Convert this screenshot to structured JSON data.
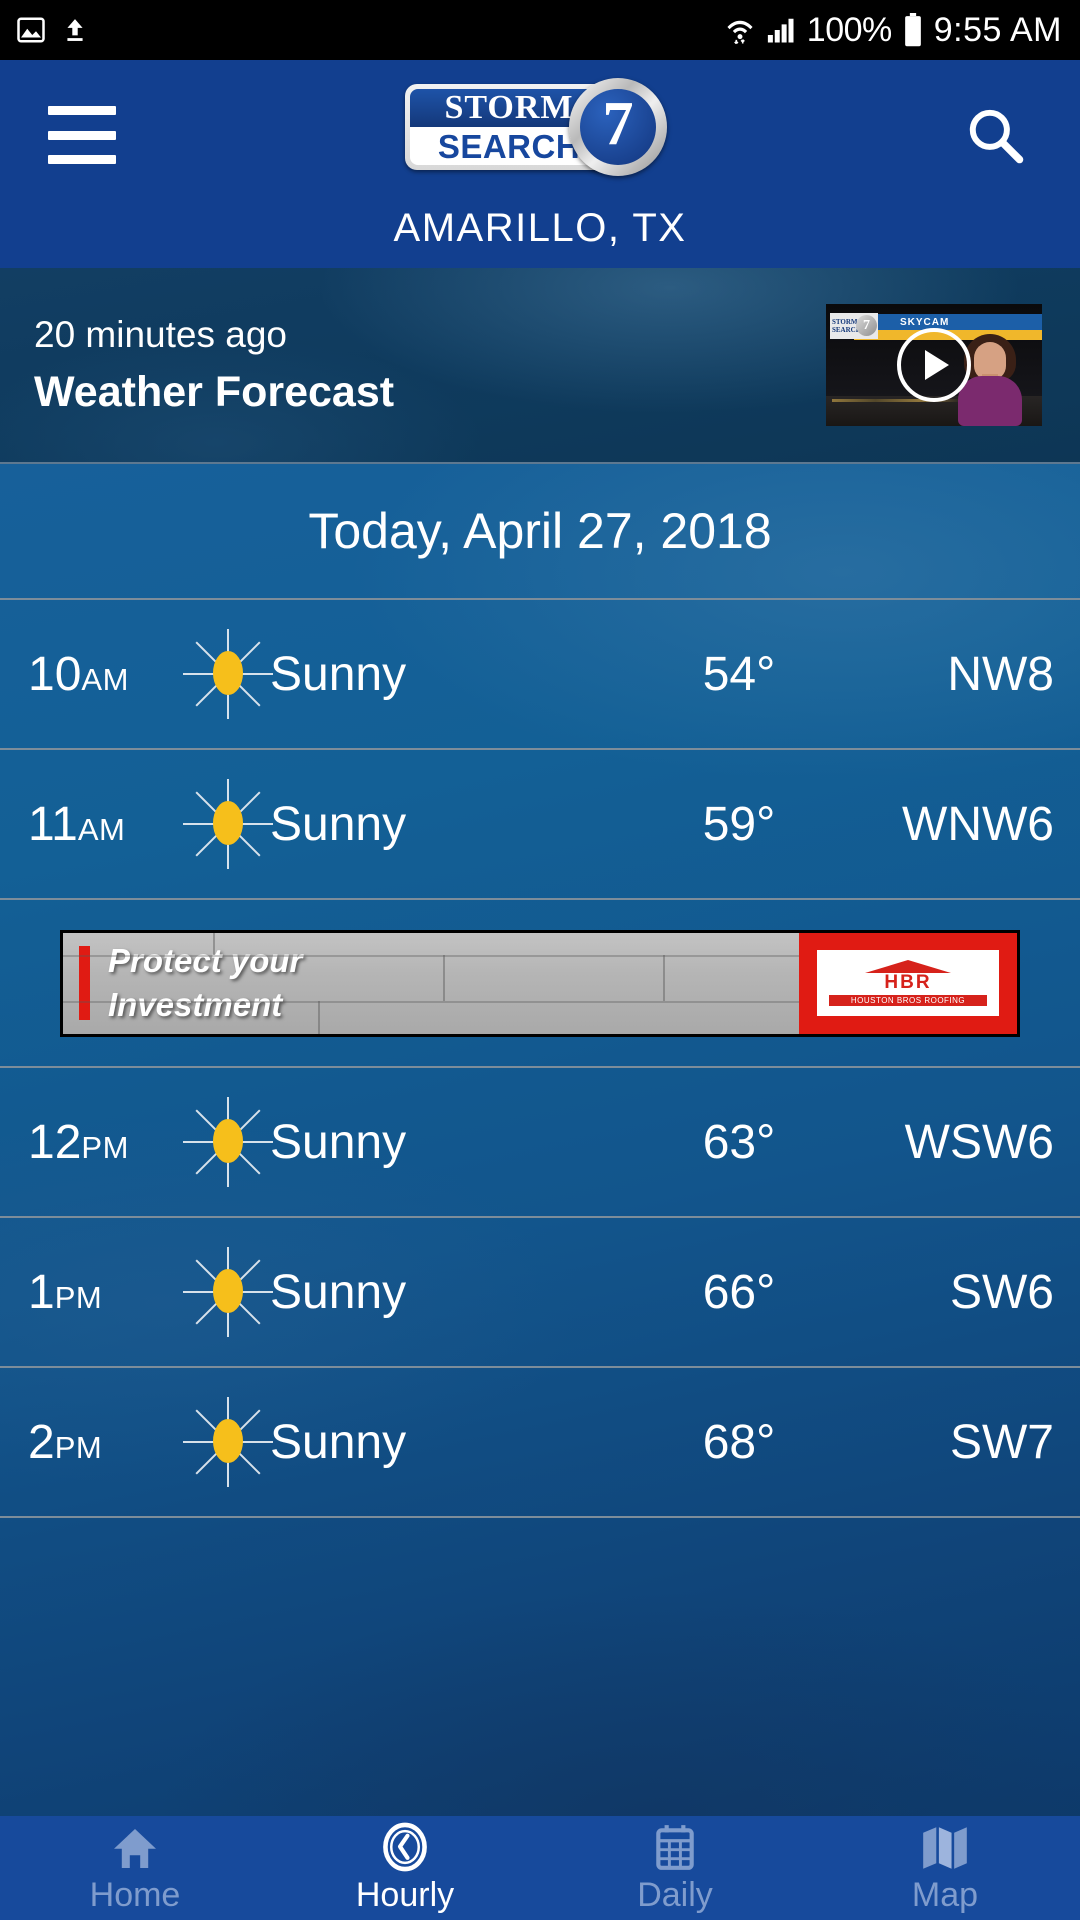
{
  "statusbar": {
    "icons": [
      "image-icon",
      "upload-icon",
      "wifi-icon",
      "cell-signal-icon",
      "battery-icon"
    ],
    "battery_percent": "100%",
    "time": "9:55 AM"
  },
  "header": {
    "menu_icon": "hamburger-menu-icon",
    "search_icon": "search-icon",
    "logo": {
      "line1": "STORM",
      "line2": "SEARCH",
      "channel": "7"
    },
    "city": "AMARILLO, TX"
  },
  "video": {
    "timestamp": "20 minutes ago",
    "title": "Weather Forecast",
    "thumbnail": {
      "banner": "SKYCAM",
      "logo_line1": "STORM",
      "logo_line2": "SEARCH",
      "logo_channel": "7"
    },
    "play_icon": "play-icon"
  },
  "forecast": {
    "date_header": "Today, April 27, 2018",
    "rows": [
      {
        "time": "10",
        "meridiem": "AM",
        "icon": "sun-icon",
        "condition": "Sunny",
        "temp": "54°",
        "wind": "NW8"
      },
      {
        "time": "11",
        "meridiem": "AM",
        "icon": "sun-icon",
        "condition": "Sunny",
        "temp": "59°",
        "wind": "WNW6"
      },
      {
        "time": "12",
        "meridiem": "PM",
        "icon": "sun-icon",
        "condition": "Sunny",
        "temp": "63°",
        "wind": "WSW6"
      },
      {
        "time": "1",
        "meridiem": "PM",
        "icon": "sun-icon",
        "condition": "Sunny",
        "temp": "66°",
        "wind": "SW6"
      },
      {
        "time": "2",
        "meridiem": "PM",
        "icon": "sun-icon",
        "condition": "Sunny",
        "temp": "68°",
        "wind": "SW7"
      }
    ]
  },
  "ad": {
    "headline_line1": "Protect your",
    "headline_line2": "Investment",
    "brand": "HBR",
    "brand_tagline": "HOUSTON BROS ROOFING"
  },
  "nav": {
    "items": [
      {
        "label": "Home",
        "icon": "home-icon",
        "active": false
      },
      {
        "label": "Hourly",
        "icon": "clock-icon",
        "active": true
      },
      {
        "label": "Daily",
        "icon": "calendar-icon",
        "active": false
      },
      {
        "label": "Map",
        "icon": "map-icon",
        "active": false
      }
    ]
  },
  "colors": {
    "header_blue": "#123f8f",
    "nav_blue": "#174a9c",
    "sun_yellow": "#f6bf1b",
    "ad_red": "#e01b13"
  }
}
